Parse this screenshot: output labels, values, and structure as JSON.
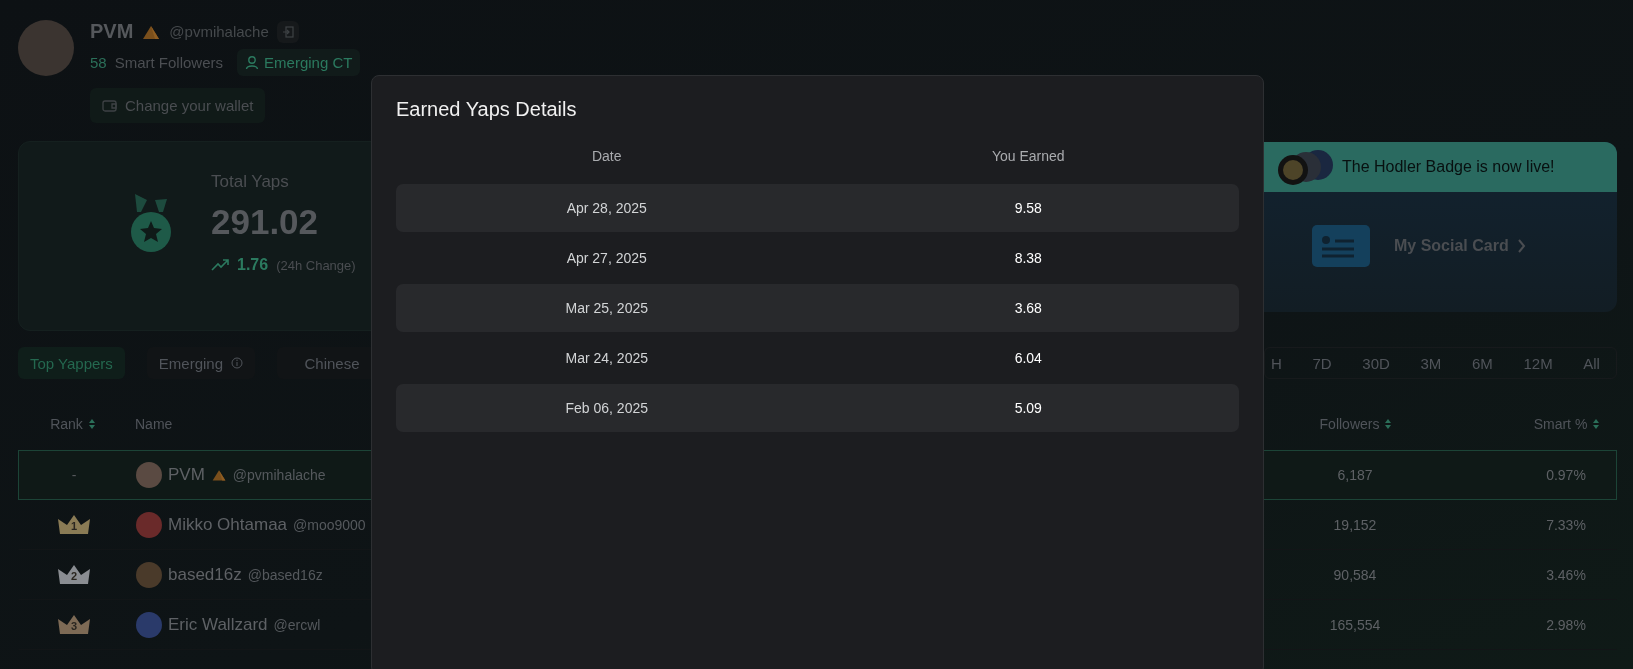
{
  "profile": {
    "name": "PVM",
    "handle": "@pvmihalache",
    "smart_followers_count": "58",
    "smart_followers_label": "Smart Followers",
    "tag": "Emerging CT",
    "wallet_button": "Change your wallet"
  },
  "total_yaps": {
    "label": "Total Yaps",
    "value": "291.02",
    "change": "1.76",
    "change_label": "(24h Change)"
  },
  "promo": {
    "banner": "The Hodler Badge is now live!",
    "link": "My Social Card"
  },
  "category_tabs": [
    {
      "label": "Top Yappers",
      "selected": true,
      "info": false
    },
    {
      "label": "Emerging",
      "selected": false,
      "info": true
    },
    {
      "label": "Chinese",
      "selected": false,
      "info": false
    }
  ],
  "period_tabs": [
    {
      "label": "H",
      "selected": false
    },
    {
      "label": "7D",
      "selected": false
    },
    {
      "label": "30D",
      "selected": false
    },
    {
      "label": "3M",
      "selected": false
    },
    {
      "label": "6M",
      "selected": false
    },
    {
      "label": "12M",
      "selected": false
    },
    {
      "label": "All",
      "selected": false
    }
  ],
  "leaderboard": {
    "columns": [
      {
        "label": "Rank",
        "sortable": true
      },
      {
        "label": "Name",
        "sortable": false
      },
      {
        "label": "Followers",
        "sortable": true
      },
      {
        "label": "Smart %",
        "sortable": true
      }
    ],
    "rows": [
      {
        "kind": "plain",
        "rank": "-",
        "name": "PVM",
        "badge": true,
        "handle": "@pvmihalache",
        "followers": "6,187",
        "smart": "0.97%",
        "selected": true
      },
      {
        "kind": "crown",
        "rank": "1",
        "color": "#8a7b55",
        "name": "Mikko Ohtamaa",
        "badge": false,
        "handle": "@moo9000",
        "followers": "19,152",
        "smart": "7.33%",
        "selected": false
      },
      {
        "kind": "crown",
        "rank": "2",
        "color": "#8a8d92",
        "name": "based16z",
        "badge": false,
        "handle": "@based16z",
        "followers": "90,584",
        "smart": "3.46%",
        "selected": false
      },
      {
        "kind": "crown",
        "rank": "3",
        "color": "#7d6a55",
        "name": "Eric Wallzard",
        "badge": false,
        "handle": "@ercwl",
        "followers": "165,554",
        "smart": "2.98%",
        "selected": false
      }
    ]
  },
  "modal": {
    "title": "Earned Yaps Details",
    "columns": [
      "Date",
      "You Earned"
    ],
    "rows": [
      {
        "date": "Apr 28, 2025",
        "earned": "9.58"
      },
      {
        "date": "Apr 27, 2025",
        "earned": "8.38"
      },
      {
        "date": "Mar 25, 2025",
        "earned": "3.68"
      },
      {
        "date": "Mar 24, 2025",
        "earned": "6.04"
      },
      {
        "date": "Feb 06, 2025",
        "earned": "5.09"
      }
    ]
  }
}
